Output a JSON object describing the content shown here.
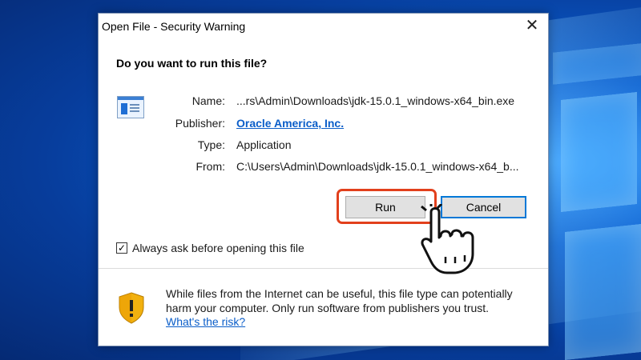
{
  "dialog": {
    "title": "Open File - Security Warning",
    "close_glyph": "✕",
    "question": "Do you want to run this file?",
    "file_icon": "application-window-icon",
    "fields": [
      {
        "label": "Name:",
        "value": "...rs\\Admin\\Downloads\\jdk-15.0.1_windows-x64_bin.exe"
      },
      {
        "label": "Publisher:",
        "value": "Oracle America, Inc."
      },
      {
        "label": "Type:",
        "value": "Application"
      },
      {
        "label": "From:",
        "value": "C:\\Users\\Admin\\Downloads\\jdk-15.0.1_windows-x64_b..."
      }
    ],
    "buttons": {
      "run": "Run",
      "cancel": "Cancel"
    },
    "checkbox": {
      "label": "Always ask before opening this file",
      "checked": true,
      "glyph": "✓"
    },
    "warning": {
      "icon": "shield-warning-icon",
      "text": "While files from the Internet can be useful, this file type can potentially harm your computer. Only run software from publishers you trust.",
      "link": "What's the risk?"
    }
  },
  "colors": {
    "link": "#0b5ec9",
    "highlight": "#e2401c",
    "cancel_border": "#0078d7",
    "desktop_blue": "#0a5fd0"
  },
  "overlay": {
    "pointer": "tap-hand-icon"
  }
}
